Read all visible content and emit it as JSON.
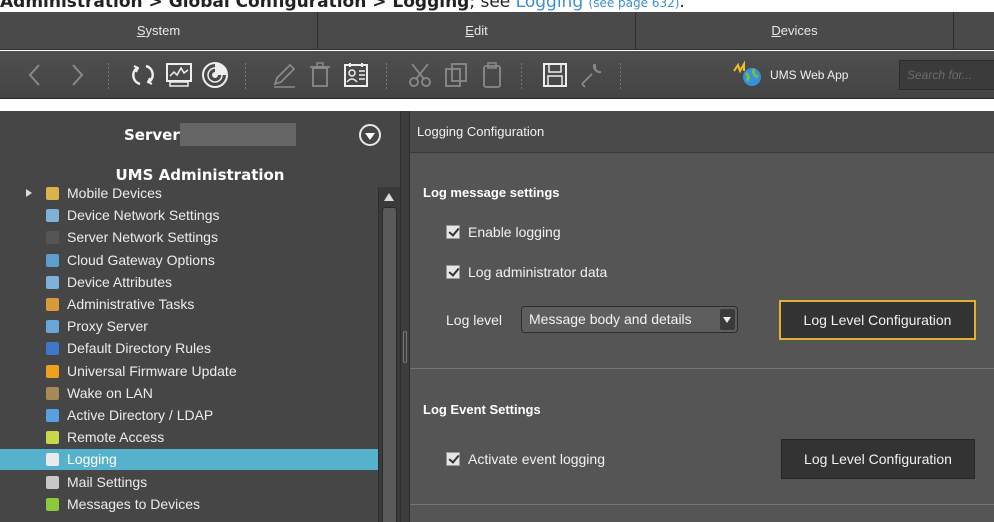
{
  "doc_caption": {
    "prefix": "Administration",
    "sep1": " > ",
    "middle": "Global Configuration",
    "sep2": " > ",
    "last": "Logging",
    "see": "; see ",
    "link": "Logging",
    "link_page": "(see page 632)",
    "end": "."
  },
  "menu": {
    "system_u": "S",
    "system_rest": "ystem",
    "edit_u": "E",
    "edit_rest": "dit",
    "devices_u": "D",
    "devices_rest": "evices"
  },
  "toolbar": {
    "icons": [
      "back-icon",
      "forward-icon",
      "refresh-icon",
      "monitor-icon",
      "radar-icon",
      "edit-icon",
      "delete-icon",
      "properties-icon",
      "cut-icon",
      "copy-icon",
      "paste-icon",
      "save-icon",
      "tools-icon"
    ],
    "webapp_label": "UMS Web App",
    "search_placeholder": "Search for..."
  },
  "sidebar": {
    "server_label": "Server",
    "title": "UMS Administration",
    "items": [
      {
        "label": "Mobile Devices",
        "icon": "folder-icon",
        "color": "#d9b44a"
      },
      {
        "label": "Device Network Settings",
        "icon": "device-network-icon",
        "color": "#7fb0d8"
      },
      {
        "label": "Server Network Settings",
        "icon": "server-network-icon",
        "color": "#555555"
      },
      {
        "label": "Cloud Gateway Options",
        "icon": "cloud-gateway-icon",
        "color": "#5a9fd0"
      },
      {
        "label": "Device Attributes",
        "icon": "device-attributes-icon",
        "color": "#7fb0d8"
      },
      {
        "label": "Administrative Tasks",
        "icon": "tasks-icon",
        "color": "#d89a3a"
      },
      {
        "label": "Proxy Server",
        "icon": "proxy-icon",
        "color": "#6aa6d8"
      },
      {
        "label": "Default Directory Rules",
        "icon": "directory-rules-icon",
        "color": "#3f78c8"
      },
      {
        "label": "Universal Firmware Update",
        "icon": "firmware-icon",
        "color": "#f0a020"
      },
      {
        "label": "Wake on LAN",
        "icon": "wake-on-lan-icon",
        "color": "#a88a5a"
      },
      {
        "label": "Active Directory / LDAP",
        "icon": "ldap-icon",
        "color": "#5a9fe0"
      },
      {
        "label": "Remote Access",
        "icon": "remote-access-icon",
        "color": "#c8d84a"
      },
      {
        "label": "Logging",
        "icon": "logging-icon",
        "color": "#eaeaea",
        "selected": true
      },
      {
        "label": "Mail Settings",
        "icon": "mail-icon",
        "color": "#c8c8c8"
      },
      {
        "label": "Messages to Devices",
        "icon": "messages-icon",
        "color": "#8cc83a"
      }
    ]
  },
  "main": {
    "header": "Logging Configuration",
    "log_message_title": "Log message settings",
    "enable_logging": "Enable logging",
    "log_admin_data": "Log administrator data",
    "log_level_label": "Log level",
    "log_level_value": "Message body and details",
    "log_level_config_btn": "Log Level Configuration",
    "log_event_title": "Log Event Settings",
    "activate_event_logging": "Activate event logging",
    "event_config_btn": "Log Level Configuration"
  },
  "colors": {
    "accent_selected": "#56b2cc",
    "focus_border": "#e0b034",
    "link": "#3a8fd0"
  }
}
